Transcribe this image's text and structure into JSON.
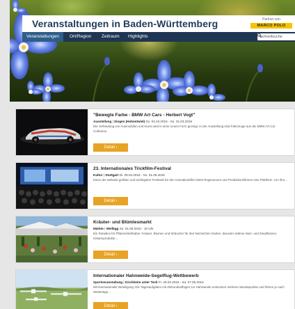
{
  "header": {
    "site_title": "Veranstaltungen in Baden-Württemberg",
    "partner_text": "Partner von",
    "partner_logo": "MARCO POLO"
  },
  "nav": {
    "items": [
      {
        "label": "Veranstaltungen",
        "active": true
      },
      {
        "label": "Ort/Region",
        "active": false
      },
      {
        "label": "Zeitraum",
        "active": false
      },
      {
        "label": "Highlights",
        "active": false
      }
    ],
    "search_label": "Schnellsuche",
    "search_icon": "search-icon"
  },
  "colors": {
    "nav_bg": "#1e3553",
    "nav_active": "#2f5d8a",
    "title_text": "#1f3b5c",
    "button": "#e7a325",
    "logo_yellow": "#f6c400"
  },
  "events": [
    {
      "title": "\"Bewegte Farbe - BMW Art Cars - Herbert Vogt\"",
      "category": "Ausstellung",
      "location": "Singen (Hohentwiel)",
      "dates": "So. 04.10.2015 - So. 31.03.2019",
      "description": "Die Verbindung von Automobilen und Kunst wird in einer neuen Form gezeigt. In der Ausstellung sind Fahrzeuge aus der BMW Art Car Collection.",
      "button": "Detail ›"
    },
    {
      "title": "23. Internationales Trickfilm-Festival",
      "category": "Kultur",
      "location": "Stuttgart",
      "dates": "Di. 29.04.2016 - So. 01.05.2016",
      "description": "Eines der weltweit größten und wichtigsten Festivals für den Animationsfilm bietet Regisseuren und Produktionsfirmen eine Plattform. Um ihre...",
      "button": "Detail ›"
    },
    {
      "title": "Kräuter- und Blümlesmarkt",
      "category": "Märkte",
      "location": "Weilbgg",
      "dates": "So. 01.05.2016 - 10 Uhr",
      "description": "Ein Paradies für Pflanzenliebhaber: Kräuter, Blumen und Sträucher für den heimischen Garten, darunter seltene Nutz- und Zierpflanzen. Kräuterprodukte...",
      "button": "Detail ›"
    },
    {
      "title": "Internationaler Hahnweide-Segelflug-Wettbewerb",
      "category": "Sportveranstaltung",
      "location": "Kirchheim unter Teck",
      "dates": "Fr. 29.04.2016 - So. 07.05.2016",
      "description": "Mit internationaler Beteiligung: Die Tagesaufgaben mit Zielrundenflügen zur Hahnweide erstrecken mehrere Wendepunkte und führen je nach Wetterlage...",
      "button": "Detail ›"
    }
  ]
}
